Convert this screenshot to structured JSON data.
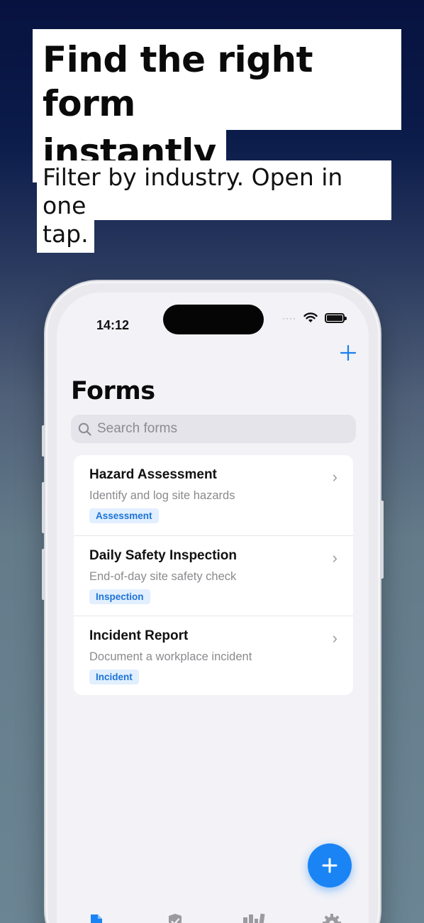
{
  "headline": {
    "line1": "Find the right form",
    "line2": "instantly"
  },
  "subheadline": {
    "line1": "Filter by industry. Open in one",
    "line2": "tap."
  },
  "status_bar": {
    "time": "14:12",
    "signal_dots": "····"
  },
  "nav": {
    "add_icon": "plus-icon"
  },
  "page": {
    "title": "Forms"
  },
  "search": {
    "placeholder": "Search forms",
    "icon": "search-icon"
  },
  "forms": [
    {
      "title": "Hazard Assessment",
      "subtitle": "Identify and log site hazards",
      "badge": "Assessment"
    },
    {
      "title": "Daily Safety Inspection",
      "subtitle": "End-of-day site safety check",
      "badge": "Inspection"
    },
    {
      "title": "Incident Report",
      "subtitle": "Document a workplace incident",
      "badge": "Incident"
    }
  ],
  "fab": {
    "icon": "plus-icon"
  },
  "tabs": [
    {
      "icon": "document-icon",
      "active": true
    },
    {
      "icon": "shield-check-icon",
      "active": false
    },
    {
      "icon": "library-icon",
      "active": false
    },
    {
      "icon": "gear-icon",
      "active": false
    }
  ],
  "colors": {
    "accent": "#1a84f5",
    "badge_bg": "#e1efff",
    "badge_text": "#1d73d6"
  }
}
